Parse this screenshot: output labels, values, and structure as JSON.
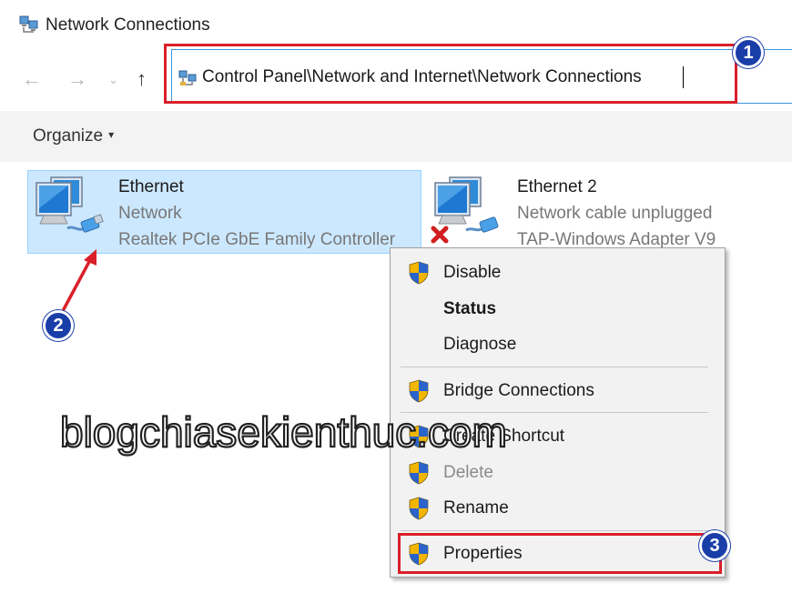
{
  "window": {
    "title": "Network Connections",
    "icon": "network-connections-icon"
  },
  "nav": {
    "back_glyph": "←",
    "forward_glyph": "→",
    "recent_glyph": "⌄",
    "up_glyph": "↑"
  },
  "address": {
    "path": "Control Panel\\Network and Internet\\Network Connections",
    "icon": "control-panel-network-icon"
  },
  "toolbar": {
    "organize_label": "Organize",
    "organize_chevron": "▾"
  },
  "connections": [
    {
      "name": "Ethernet",
      "status": "Network",
      "device": "Realtek PCIe GbE Family Controller",
      "selected": true,
      "icon": "network-adapter-icon"
    },
    {
      "name": "Ethernet 2",
      "status": "Network cable unplugged",
      "device": "TAP-Windows Adapter V9",
      "selected": false,
      "icon": "network-adapter-disconnected-icon"
    }
  ],
  "context_menu": {
    "items": [
      {
        "label": "Disable",
        "shield": true,
        "bold": false,
        "enabled": true
      },
      {
        "label": "Status",
        "shield": false,
        "bold": true,
        "enabled": true
      },
      {
        "label": "Diagnose",
        "shield": false,
        "bold": false,
        "enabled": true
      },
      {
        "label": "Bridge Connections",
        "shield": true,
        "bold": false,
        "enabled": true
      },
      {
        "label": "Create Shortcut",
        "shield": true,
        "bold": false,
        "enabled": true
      },
      {
        "label": "Delete",
        "shield": true,
        "bold": false,
        "enabled": false
      },
      {
        "label": "Rename",
        "shield": true,
        "bold": false,
        "enabled": true
      },
      {
        "label": "Properties",
        "shield": true,
        "bold": false,
        "enabled": true
      }
    ]
  },
  "annotations": {
    "badge_1": "1",
    "badge_2": "2",
    "badge_3": "3",
    "watermark": "blogchiasekienthuc.com"
  },
  "colors": {
    "highlight_red": "#d9202a",
    "badge_blue": "#1a3ea8",
    "selection_blue": "#cce8ff",
    "address_border": "#3a96dd"
  }
}
